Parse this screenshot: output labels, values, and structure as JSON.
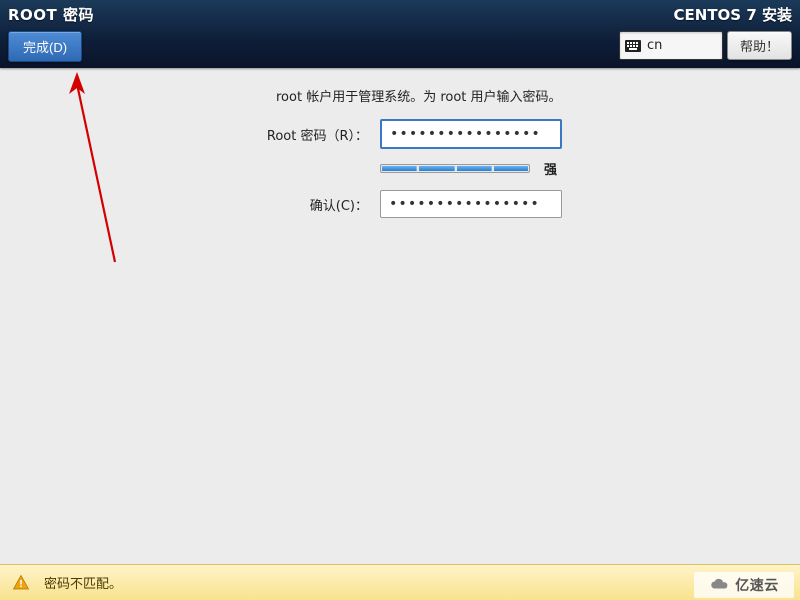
{
  "header": {
    "page_title": "ROOT 密码",
    "done_label": "完成(D)",
    "installer_title": "CENTOS 7 安装",
    "lang_code": "cn",
    "help_label": "帮助！"
  },
  "main": {
    "description": "root 帐户用于管理系统。为 root 用户输入密码。",
    "password_label": "Root 密码（R）：",
    "password_value": "••••••••••••••••",
    "confirm_label": "确认(C)：",
    "confirm_value": "••••••••••••••••",
    "strength_label": "强"
  },
  "warning": {
    "message": "密码不匹配。"
  },
  "watermark": {
    "text": "亿速云"
  },
  "colors": {
    "header_bg": "#0e1e38",
    "primary_button": "#2f69b3",
    "input_focus_border": "#3b78c4",
    "strength_segment": "#2b7ed1",
    "warning_bg": "#f8e38e",
    "annotation_red": "#d40000"
  }
}
